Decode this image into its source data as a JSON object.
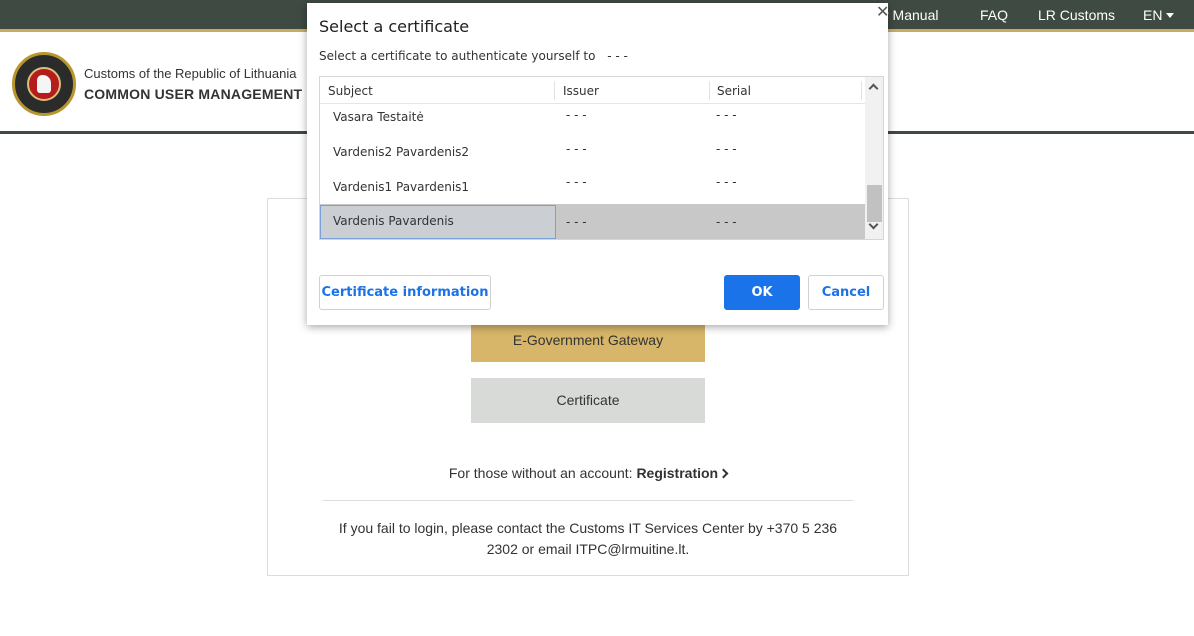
{
  "nav": {
    "user_manual": "r Manual",
    "faq": "FAQ",
    "lr_customs": "LR Customs",
    "lang": "EN"
  },
  "header": {
    "org_name": "Customs of the Republic of Lithuania",
    "system_name": "COMMON USER MANAGEMENT P"
  },
  "login": {
    "gateway_label": "E-Government Gateway",
    "certificate_label": "Certificate",
    "register_prefix": "For those without an account:",
    "register_link": "Registration",
    "contact_text": "If you fail to login, please contact the Customs IT Services Center by +370 5 236 2302 or email ITPC@lrmuitine.lt."
  },
  "dialog": {
    "title": "Select a certificate",
    "subtitle": "Select a certificate to authenticate yourself to",
    "subtitle_target": "- - -",
    "columns": {
      "subject": "Subject",
      "issuer": "Issuer",
      "serial": "Serial"
    },
    "rows": [
      {
        "subject": "Vasara Testaitė",
        "issuer": "- - -",
        "serial": "- - -"
      },
      {
        "subject": "Vardenis2 Pavardenis2",
        "issuer": "- - -",
        "serial": "- - -"
      },
      {
        "subject": "Vardenis1 Pavardenis1",
        "issuer": "- - -",
        "serial": "- - -"
      },
      {
        "subject": "Vardenis Pavardenis",
        "issuer": "- - -",
        "serial": "- - -",
        "selected": true
      }
    ],
    "buttons": {
      "info": "Certificate information",
      "ok": "OK",
      "cancel": "Cancel"
    },
    "close": "✕"
  },
  "colors": {
    "topbar": "#3f4a42",
    "accent_gold": "#c9ab62",
    "gateway_button": "#d7b569",
    "primary_blue": "#1a73e8"
  }
}
